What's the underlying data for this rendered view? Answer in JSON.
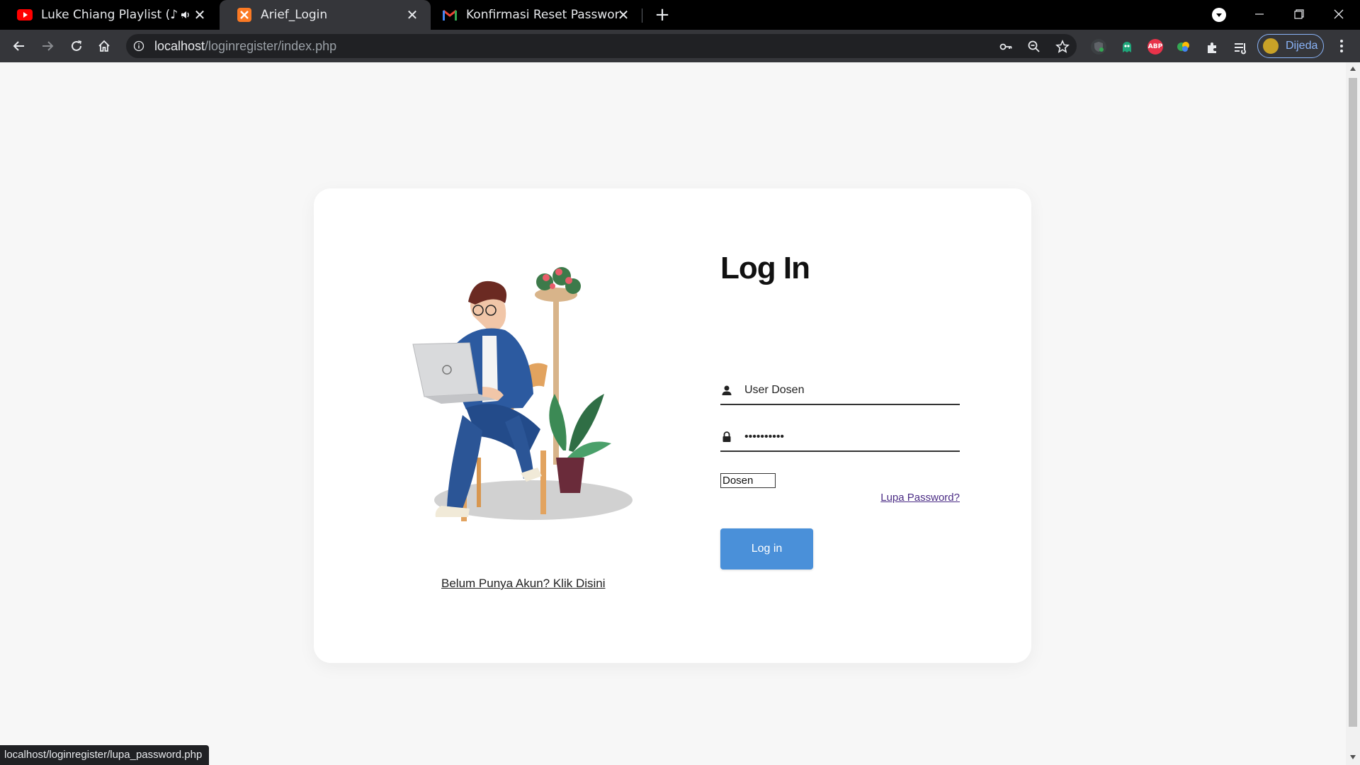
{
  "browser": {
    "tabs": [
      {
        "title": "Luke Chiang Playlist (♪ songs",
        "favicon": "youtube-icon",
        "audio": "speaker-icon"
      },
      {
        "title": "Arief_Login",
        "favicon": "xampp-icon",
        "active": true
      },
      {
        "title": "Konfirmasi Reset Password - baih",
        "favicon": "gmail-icon"
      }
    ],
    "address_bar": {
      "host": "localhost",
      "path": "/loginregister/index.php"
    },
    "profile_chip_label": "Dijeda",
    "status_url": "localhost/loginregister/lupa_password.php"
  },
  "login_card": {
    "title": "Log In",
    "username_value": "User Dosen",
    "password_value": "••••••••••",
    "role_selected": "Dosen",
    "forgot_link": "Lupa Password?",
    "login_button": "Log in",
    "signup_link": "Belum Punya Akun? Klik Disini"
  },
  "colors": {
    "accent_button": "#4a90d9",
    "forgot_link": "#4b2c85",
    "page_background": "#f7f7f7"
  }
}
